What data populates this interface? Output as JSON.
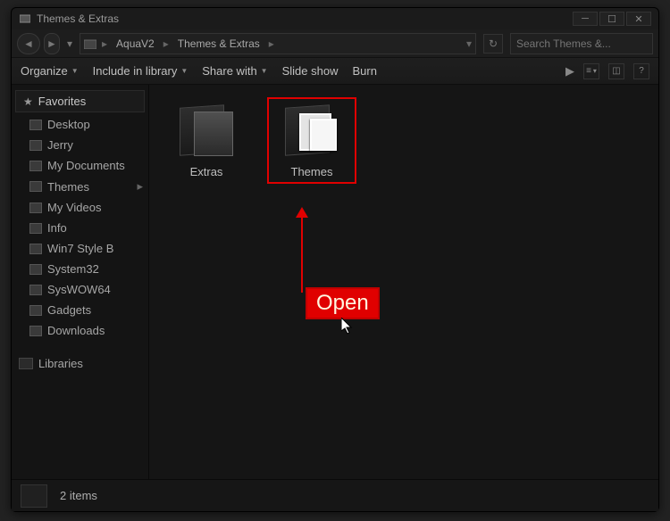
{
  "window": {
    "title": "Themes & Extras"
  },
  "nav": {
    "breadcrumb": [
      "AquaV2",
      "Themes & Extras"
    ],
    "search_placeholder": "Search Themes &..."
  },
  "toolbar": {
    "organize": "Organize",
    "include": "Include in library",
    "share": "Share with",
    "slideshow": "Slide show",
    "burn": "Burn"
  },
  "sidebar": {
    "favorites_label": "Favorites",
    "items": [
      {
        "label": "Desktop"
      },
      {
        "label": "Jerry"
      },
      {
        "label": "My Documents"
      },
      {
        "label": "Themes"
      },
      {
        "label": "My Videos"
      },
      {
        "label": "Info"
      },
      {
        "label": "Win7 Style B"
      },
      {
        "label": "System32"
      },
      {
        "label": "SysWOW64"
      },
      {
        "label": "Gadgets"
      },
      {
        "label": "Downloads"
      }
    ],
    "libraries_label": "Libraries"
  },
  "content": {
    "folders": [
      {
        "label": "Extras",
        "selected": false,
        "type": "plain"
      },
      {
        "label": "Themes",
        "selected": true,
        "type": "themes"
      }
    ]
  },
  "annotation": {
    "label": "Open"
  },
  "status": {
    "text": "2 items"
  }
}
